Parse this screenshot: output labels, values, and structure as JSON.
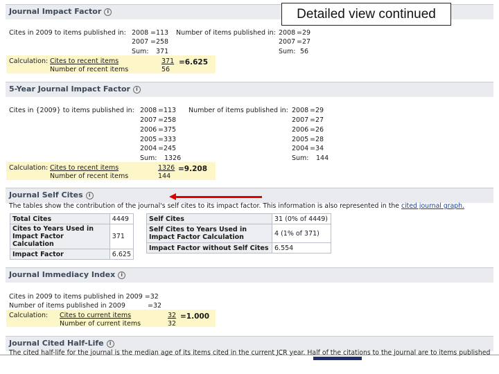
{
  "banner": "Detailed view continued",
  "jif": {
    "title": "Journal Impact Factor",
    "cites_label": "Cites in 2009 to items published in:",
    "cites": [
      {
        "year": "2008",
        "val": "=113"
      },
      {
        "year": "2007",
        "val": "=258"
      }
    ],
    "cites_sum": {
      "label": "Sum:",
      "val": "371"
    },
    "items_label": "Number of items published in:",
    "items": [
      {
        "year": "2008",
        "val": "=29"
      },
      {
        "year": "2007",
        "val": "=27"
      }
    ],
    "items_sum": {
      "label": "Sum:",
      "val": "56"
    },
    "calc_label": "Calculation:",
    "calc_top": "Cites to recent items",
    "calc_bottom": "Number of recent items",
    "calc_top_val": "371",
    "calc_bottom_val": "56",
    "result": "=6.625"
  },
  "fy": {
    "title": "5-Year Journal Impact Factor",
    "cites_label": "Cites in {2009} to items published in:",
    "cites": [
      {
        "year": "2008",
        "val": "=113"
      },
      {
        "year": "2007",
        "val": "=258"
      },
      {
        "year": "2006",
        "val": "=375"
      },
      {
        "year": "2005",
        "val": "=333"
      },
      {
        "year": "2004",
        "val": "=245"
      }
    ],
    "cites_sum": {
      "label": "Sum:",
      "val": "1326"
    },
    "items_label": "Number of items published in:",
    "items": [
      {
        "year": "2008",
        "val": "=29"
      },
      {
        "year": "2007",
        "val": "=27"
      },
      {
        "year": "2006",
        "val": "=26"
      },
      {
        "year": "2005",
        "val": "=28"
      },
      {
        "year": "2004",
        "val": "=34"
      }
    ],
    "items_sum": {
      "label": "Sum:",
      "val": "144"
    },
    "calc_label": "Calculation:",
    "calc_top": "Cites to recent items",
    "calc_bottom": "Number of recent items",
    "calc_top_val": "1326",
    "calc_bottom_val": "144",
    "result": "=9.208"
  },
  "selfcites": {
    "title": "Journal Self Cites",
    "desc_before": "The tables show the contribution of the journal's self cites to its impact factor. This information is also represented in the",
    "desc_link": "cited journal graph.",
    "left_table": [
      {
        "label": "Total Cites",
        "value": "4449"
      },
      {
        "label": "Cites to Years Used in Impact Factor Calculation",
        "value": "371"
      },
      {
        "label": "Impact Factor",
        "value": "6.625"
      }
    ],
    "right_table": [
      {
        "label": "Self Cites",
        "value": "31 (0% of 4449)"
      },
      {
        "label": "Self Cites to Years Used in Impact Factor Calculation",
        "value": "4 (1% of 371)"
      },
      {
        "label": "Impact Factor without Self Cites",
        "value": "6.554"
      }
    ]
  },
  "immediacy": {
    "title": "Journal Immediacy Index",
    "line1": "Cites in 2009 to items published in 2009 =32",
    "line2_label": "Number of items published in 2009",
    "line2_val": "=32",
    "calc_label": "Calculation:",
    "calc_top": "Cites to current items",
    "calc_bottom": "Number of current items",
    "calc_top_val": "32",
    "calc_bottom_val": "32",
    "result": "=1.000"
  },
  "halflife": {
    "title": "Journal Cited Half-Life",
    "desc": "The cited half-life for the journal is the median age of its items cited in the current JCR year. Half of the citations to the journal are to items published"
  },
  "icons": {
    "info": "info-icon",
    "arrow": "red-arrow-left"
  },
  "colors": {
    "header_bg": "#e9ebee",
    "calc_bg": "#fcf6c8",
    "arrow": "#e00000",
    "link": "#1f3f99"
  }
}
